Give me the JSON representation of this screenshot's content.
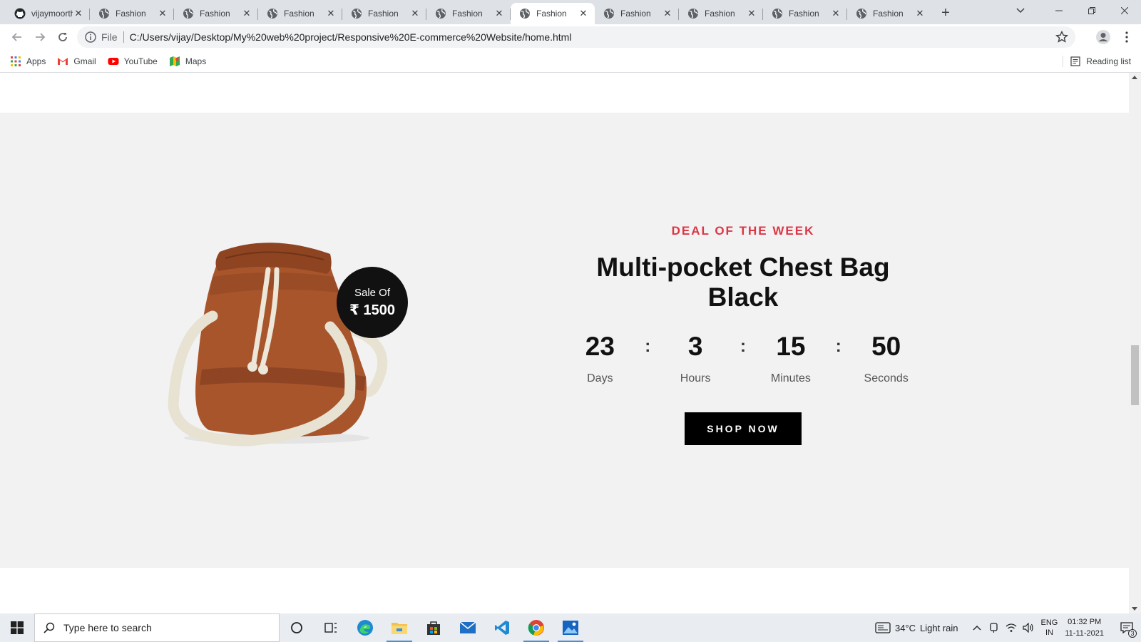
{
  "browser": {
    "tabs": [
      {
        "title": "vijaymoorthy",
        "favicon": "github-icon"
      },
      {
        "title": "Fashion",
        "favicon": "globe-icon"
      },
      {
        "title": "Fashion",
        "favicon": "globe-icon"
      },
      {
        "title": "Fashion",
        "favicon": "globe-icon"
      },
      {
        "title": "Fashion",
        "favicon": "globe-icon"
      },
      {
        "title": "Fashion",
        "favicon": "globe-icon"
      },
      {
        "title": "Fashion",
        "favicon": "globe-icon",
        "active": true
      },
      {
        "title": "Fashion",
        "favicon": "globe-icon"
      },
      {
        "title": "Fashion",
        "favicon": "globe-icon"
      },
      {
        "title": "Fashion",
        "favicon": "globe-icon"
      },
      {
        "title": "Fashion",
        "favicon": "globe-icon"
      }
    ],
    "close_glyph": "✕",
    "new_tab_glyph": "+",
    "address": {
      "scheme_label": "File",
      "url": "C:/Users/vijay/Desktop/My%20web%20project/Responsive%20E-commerce%20Website/home.html"
    },
    "bookmarks": [
      {
        "label": "Apps",
        "icon": "apps-grid-icon"
      },
      {
        "label": "Gmail",
        "icon": "gmail-icon"
      },
      {
        "label": "YouTube",
        "icon": "youtube-icon"
      },
      {
        "label": "Maps",
        "icon": "maps-icon"
      }
    ],
    "reading_list_label": "Reading list"
  },
  "deal": {
    "badge_label": "Sale Of",
    "badge_price": "₹ 1500",
    "tag": "DEAL OF THE WEEK",
    "title": "Multi-pocket Chest Bag Black",
    "countdown": [
      {
        "value": "23",
        "label": "Days"
      },
      {
        "value": "3",
        "label": "Hours"
      },
      {
        "value": "15",
        "label": "Minutes"
      },
      {
        "value": "50",
        "label": "Seconds"
      }
    ],
    "separator": ":",
    "button_label": "SHOP NOW",
    "colors": {
      "tag": "#dc3545",
      "section_bg": "#f2f2f2",
      "button_bg": "#000000",
      "bag": "#a8552b",
      "strap": "#e8e2d2"
    }
  },
  "taskbar": {
    "search_placeholder": "Type here to search",
    "weather_temp": "34°C",
    "weather_desc": "Light rain",
    "lang_line1": "ENG",
    "lang_line2": "IN",
    "time": "01:32 PM",
    "date": "11-11-2021",
    "notification_count": "3"
  }
}
